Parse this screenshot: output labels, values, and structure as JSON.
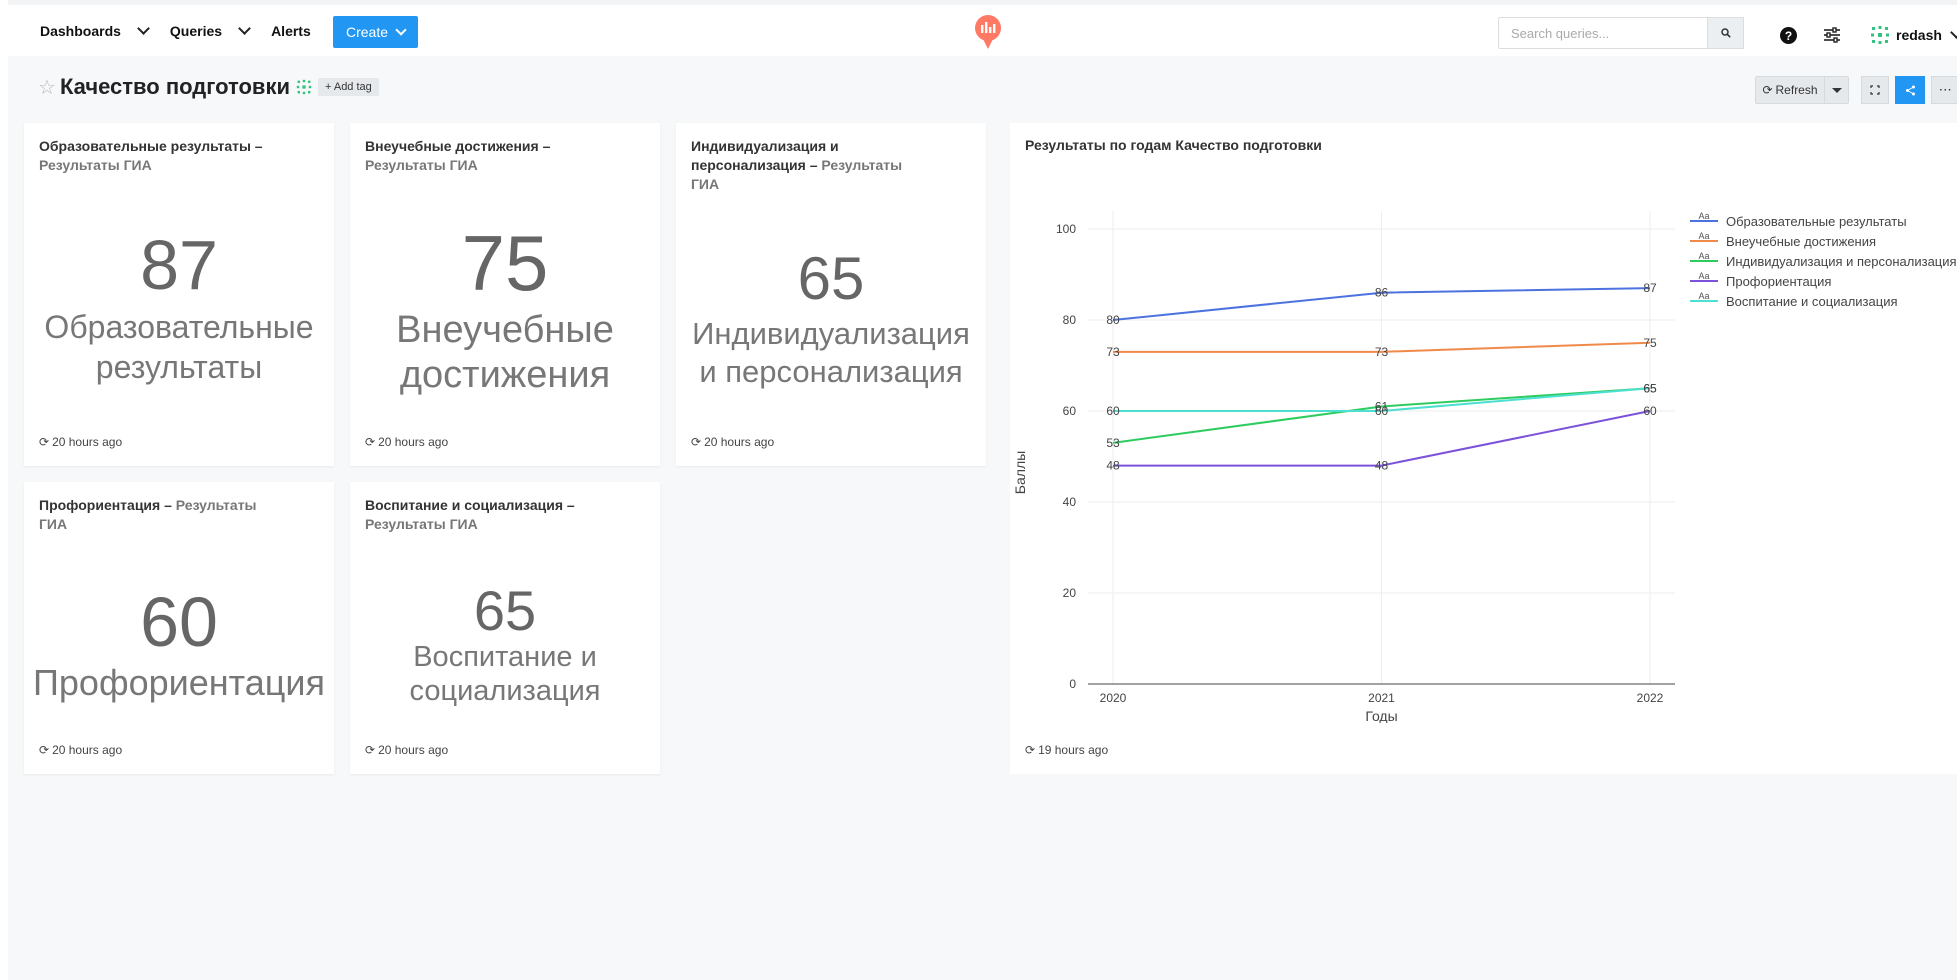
{
  "nav": {
    "dashboards": "Dashboards",
    "queries": "Queries",
    "alerts": "Alerts",
    "create": "Create",
    "search_placeholder": "Search queries...",
    "user_name": "redash"
  },
  "dashboard": {
    "title": "Качество подготовки",
    "add_tag": "+ Add tag",
    "refresh": "Refresh"
  },
  "widgets": [
    {
      "title": "Образовательные результаты",
      "sep": " – ",
      "subtitle": "Результаты ГИА",
      "value": "87",
      "label1": "Образовательные",
      "label2": "результаты",
      "updated": "20 hours ago"
    },
    {
      "title": "Внеучебные достижения",
      "sep": " – ",
      "subtitle": "Результаты ГИА",
      "value": "75",
      "label1": "Внеучебные",
      "label2": "достижения",
      "updated": "20 hours ago"
    },
    {
      "title1": "Индивидуализация и",
      "title2": "персонализация",
      "sep": " – ",
      "subtitle1": "Результаты",
      "subtitle2": "ГИА",
      "value": "65",
      "label1": "Индивидуализация",
      "label2": "и персонализация",
      "updated": "20 hours ago"
    },
    {
      "title": "Профориентация",
      "sep": " – ",
      "subtitle1": "Результаты",
      "subtitle2": "ГИА",
      "value": "60",
      "label1": "Профориентация",
      "updated": "20 hours ago"
    },
    {
      "title": "Воспитание и социализация",
      "sep": " – ",
      "subtitle": "Результаты ГИА",
      "value": "65",
      "label1": "Воспитание и",
      "label2": "социализация",
      "updated": "20 hours ago"
    }
  ],
  "chart_widget": {
    "title": "Результаты по годам Качество подготовки",
    "updated": "19 hours ago"
  },
  "chart_data": {
    "type": "line",
    "title": "Результаты по годам Качество подготовки",
    "xlabel": "Годы",
    "ylabel": "Баллы",
    "x": [
      "2020",
      "2021",
      "2022"
    ],
    "ylim": [
      0,
      100
    ],
    "yticks": [
      0,
      20,
      40,
      60,
      80,
      100
    ],
    "grid": true,
    "legend_position": "top-right",
    "legend_marker": "Aa",
    "series": [
      {
        "name": "Образовательные результаты",
        "color": "#4c72e0",
        "values": [
          80,
          86,
          87
        ]
      },
      {
        "name": "Внеучебные достижения",
        "color": "#f08a4b",
        "values": [
          73,
          73,
          75
        ]
      },
      {
        "name": "Индивидуализация и персонализация",
        "color": "#2ecc5f",
        "values": [
          53,
          61,
          65
        ]
      },
      {
        "name": "Профориентация",
        "color": "#7b52d9",
        "values": [
          48,
          48,
          60
        ]
      },
      {
        "name": "Воспитание и социализация",
        "color": "#4de0d0",
        "values": [
          60,
          60,
          65
        ]
      }
    ]
  }
}
